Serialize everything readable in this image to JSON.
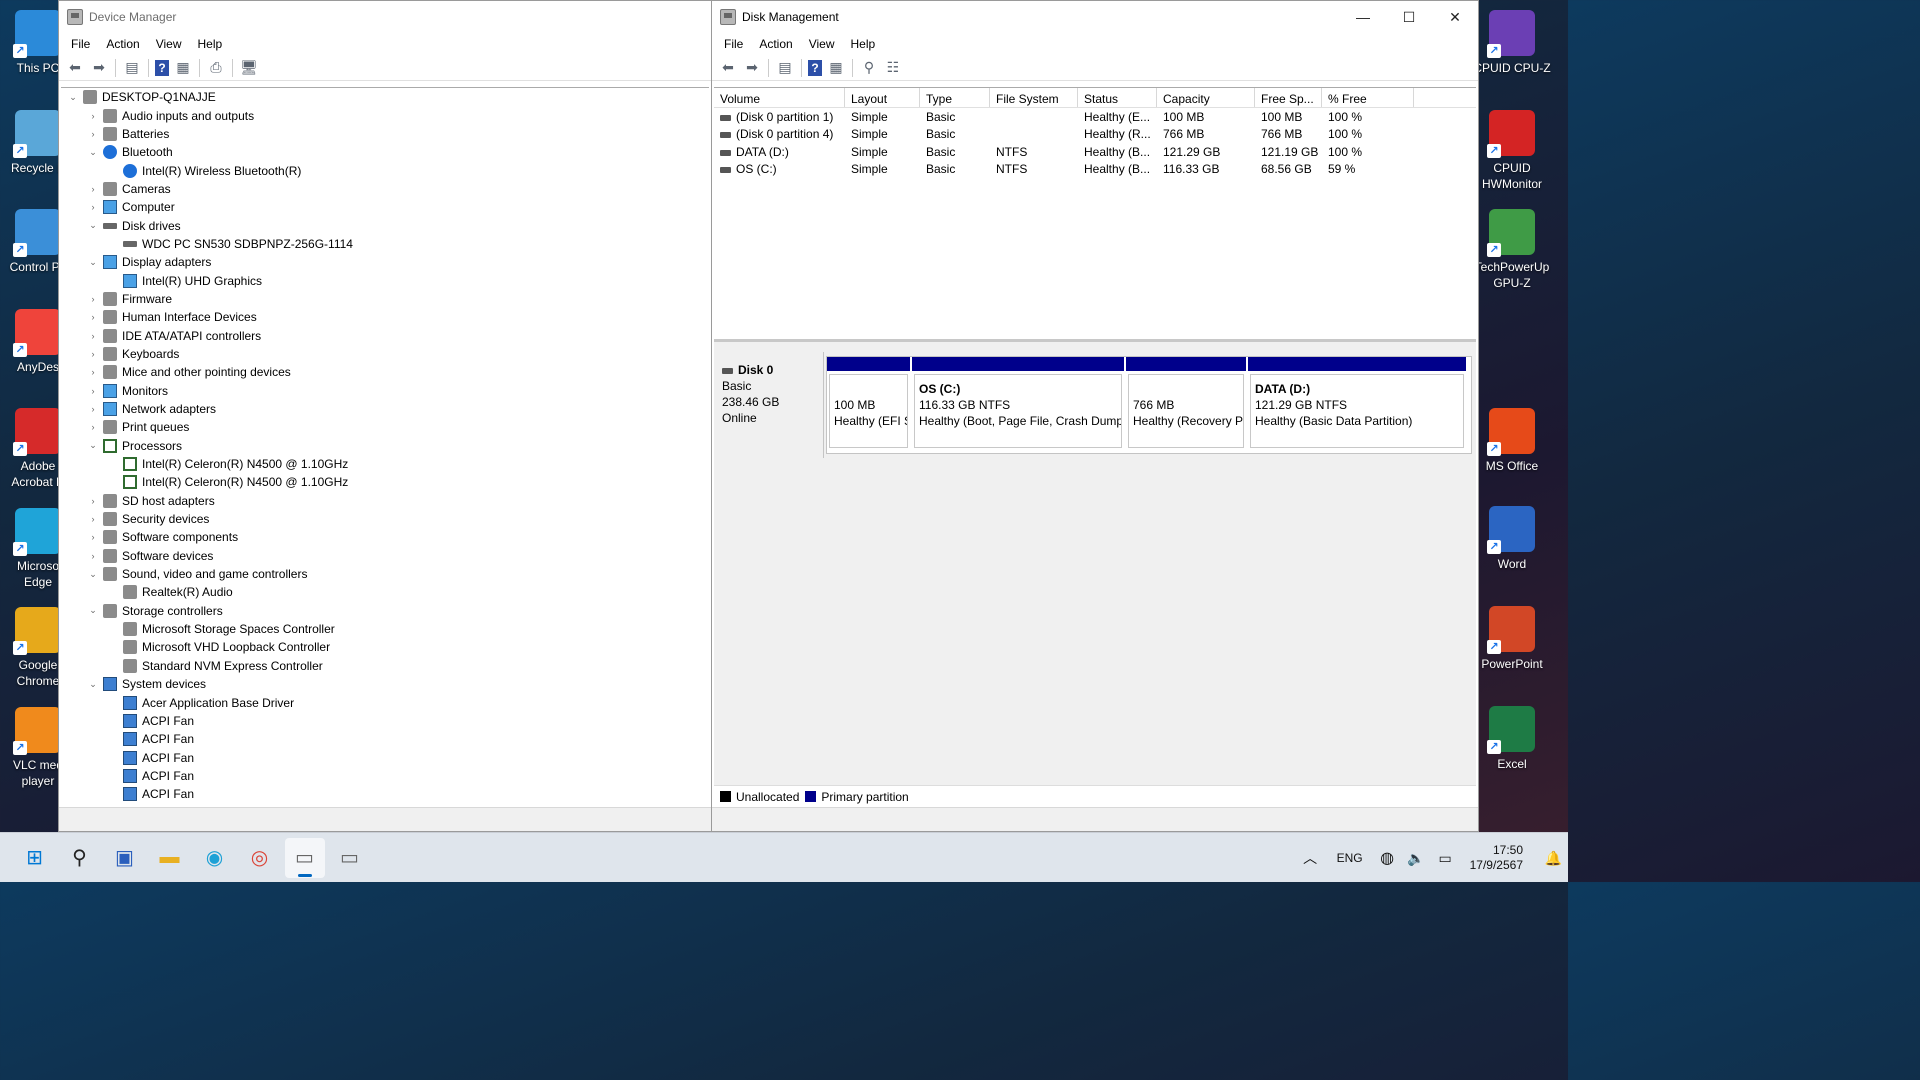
{
  "desktop": {
    "left_icons": [
      {
        "label": "This PC",
        "icon": "this-pc-icon",
        "color": "#2b8ad9"
      },
      {
        "label": "Recycle B",
        "icon": "recycle-bin-icon",
        "color": "#5aa7d8"
      },
      {
        "label": "Control Pa",
        "icon": "control-panel-icon",
        "color": "#3b8fd8"
      },
      {
        "label": "AnyDes",
        "icon": "anydesk-icon",
        "color": "#ef443b"
      },
      {
        "label": "Adobe\nAcrobat D",
        "icon": "acrobat-icon",
        "color": "#d62a2a"
      },
      {
        "label": "Microso\nEdge",
        "icon": "edge-icon",
        "color": "#1fa4d8"
      },
      {
        "label": "Google\nChrome",
        "icon": "chrome-icon",
        "color": "#e6a91b"
      },
      {
        "label": "VLC med\nplayer",
        "icon": "vlc-icon",
        "color": "#f08a1c"
      }
    ],
    "right_icons": [
      {
        "label": "CPUID CPU-Z",
        "icon": "cpuz-icon",
        "color": "#6b3fb4"
      },
      {
        "label": "CPUID\nHWMonitor",
        "icon": "hwmonitor-icon",
        "color": "#d42424"
      },
      {
        "label": "TechPowerUp\nGPU-Z",
        "icon": "gpuz-icon",
        "color": "#3f9b46"
      },
      {
        "label": "MS Office",
        "icon": "ms-office-icon",
        "color": "#e64a19"
      },
      {
        "label": "Word",
        "icon": "word-icon",
        "color": "#2b65c2"
      },
      {
        "label": "PowerPoint",
        "icon": "powerpoint-icon",
        "color": "#d24726"
      },
      {
        "label": "Excel",
        "icon": "excel-icon",
        "color": "#1e7b45"
      }
    ]
  },
  "device_manager": {
    "title": "Device Manager",
    "menu": [
      "File",
      "Action",
      "View",
      "Help"
    ],
    "tree": [
      {
        "level": 0,
        "chev": "⌄",
        "label": "DESKTOP-Q1NAJJE",
        "icon": "computer-icon",
        "cls": "ico-gray"
      },
      {
        "level": 1,
        "chev": "›",
        "label": "Audio inputs and outputs",
        "icon": "speaker-icon",
        "cls": "ico-gray"
      },
      {
        "level": 1,
        "chev": "›",
        "label": "Batteries",
        "icon": "battery-icon",
        "cls": "ico-gray"
      },
      {
        "level": 1,
        "chev": "⌄",
        "label": "Bluetooth",
        "icon": "bluetooth-icon",
        "cls": "ico-bt"
      },
      {
        "level": 2,
        "chev": "",
        "label": "Intel(R) Wireless Bluetooth(R)",
        "icon": "bluetooth-icon",
        "cls": "ico-bt"
      },
      {
        "level": 1,
        "chev": "›",
        "label": "Cameras",
        "icon": "camera-icon",
        "cls": "ico-gray"
      },
      {
        "level": 1,
        "chev": "›",
        "label": "Computer",
        "icon": "monitor-icon",
        "cls": "ico-monitor"
      },
      {
        "level": 1,
        "chev": "⌄",
        "label": "Disk drives",
        "icon": "disk-drive-icon",
        "cls": "ico-disk"
      },
      {
        "level": 2,
        "chev": "",
        "label": "WDC PC SN530 SDBPNPZ-256G-1114",
        "icon": "disk-drive-icon",
        "cls": "ico-disk"
      },
      {
        "level": 1,
        "chev": "⌄",
        "label": "Display adapters",
        "icon": "display-adapter-icon",
        "cls": "ico-monitor"
      },
      {
        "level": 2,
        "chev": "",
        "label": "Intel(R) UHD Graphics",
        "icon": "display-adapter-icon",
        "cls": "ico-monitor"
      },
      {
        "level": 1,
        "chev": "›",
        "label": "Firmware",
        "icon": "firmware-icon",
        "cls": "ico-gray"
      },
      {
        "level": 1,
        "chev": "›",
        "label": "Human Interface Devices",
        "icon": "hid-icon",
        "cls": "ico-gray"
      },
      {
        "level": 1,
        "chev": "›",
        "label": "IDE ATA/ATAPI controllers",
        "icon": "ide-controller-icon",
        "cls": "ico-gray"
      },
      {
        "level": 1,
        "chev": "›",
        "label": "Keyboards",
        "icon": "keyboard-icon",
        "cls": "ico-gray"
      },
      {
        "level": 1,
        "chev": "›",
        "label": "Mice and other pointing devices",
        "icon": "mouse-icon",
        "cls": "ico-gray"
      },
      {
        "level": 1,
        "chev": "›",
        "label": "Monitors",
        "icon": "monitor-icon",
        "cls": "ico-monitor"
      },
      {
        "level": 1,
        "chev": "›",
        "label": "Network adapters",
        "icon": "network-adapter-icon",
        "cls": "ico-monitor"
      },
      {
        "level": 1,
        "chev": "›",
        "label": "Print queues",
        "icon": "printer-icon",
        "cls": "ico-gray"
      },
      {
        "level": 1,
        "chev": "⌄",
        "label": "Processors",
        "icon": "processor-icon",
        "cls": "ico-cpu"
      },
      {
        "level": 2,
        "chev": "",
        "label": "Intel(R) Celeron(R) N4500 @ 1.10GHz",
        "icon": "processor-icon",
        "cls": "ico-cpu"
      },
      {
        "level": 2,
        "chev": "",
        "label": "Intel(R) Celeron(R) N4500 @ 1.10GHz",
        "icon": "processor-icon",
        "cls": "ico-cpu"
      },
      {
        "level": 1,
        "chev": "›",
        "label": "SD host adapters",
        "icon": "sd-adapter-icon",
        "cls": "ico-gray"
      },
      {
        "level": 1,
        "chev": "›",
        "label": "Security devices",
        "icon": "security-device-icon",
        "cls": "ico-gray"
      },
      {
        "level": 1,
        "chev": "›",
        "label": "Software components",
        "icon": "software-component-icon",
        "cls": "ico-gray"
      },
      {
        "level": 1,
        "chev": "›",
        "label": "Software devices",
        "icon": "software-device-icon",
        "cls": "ico-gray"
      },
      {
        "level": 1,
        "chev": "⌄",
        "label": "Sound, video and game controllers",
        "icon": "speaker-icon",
        "cls": "ico-gray"
      },
      {
        "level": 2,
        "chev": "",
        "label": "Realtek(R) Audio",
        "icon": "speaker-icon",
        "cls": "ico-gray"
      },
      {
        "level": 1,
        "chev": "⌄",
        "label": "Storage controllers",
        "icon": "storage-controller-icon",
        "cls": "ico-gray"
      },
      {
        "level": 2,
        "chev": "",
        "label": "Microsoft Storage Spaces Controller",
        "icon": "storage-controller-icon",
        "cls": "ico-gray"
      },
      {
        "level": 2,
        "chev": "",
        "label": "Microsoft VHD Loopback Controller",
        "icon": "storage-controller-icon",
        "cls": "ico-gray"
      },
      {
        "level": 2,
        "chev": "",
        "label": "Standard NVM Express Controller",
        "icon": "storage-controller-icon",
        "cls": "ico-gray"
      },
      {
        "level": 1,
        "chev": "⌄",
        "label": "System devices",
        "icon": "system-device-icon",
        "cls": "ico-sys"
      },
      {
        "level": 2,
        "chev": "",
        "label": "Acer Application Base Driver",
        "icon": "system-device-icon",
        "cls": "ico-sys"
      },
      {
        "level": 2,
        "chev": "",
        "label": "ACPI Fan",
        "icon": "system-device-icon",
        "cls": "ico-sys"
      },
      {
        "level": 2,
        "chev": "",
        "label": "ACPI Fan",
        "icon": "system-device-icon",
        "cls": "ico-sys"
      },
      {
        "level": 2,
        "chev": "",
        "label": "ACPI Fan",
        "icon": "system-device-icon",
        "cls": "ico-sys"
      },
      {
        "level": 2,
        "chev": "",
        "label": "ACPI Fan",
        "icon": "system-device-icon",
        "cls": "ico-sys"
      },
      {
        "level": 2,
        "chev": "",
        "label": "ACPI Fan",
        "icon": "system-device-icon",
        "cls": "ico-sys"
      }
    ]
  },
  "disk_management": {
    "title": "Disk Management",
    "menu": [
      "File",
      "Action",
      "View",
      "Help"
    ],
    "columns": [
      "Volume",
      "Layout",
      "Type",
      "File System",
      "Status",
      "Capacity",
      "Free Sp...",
      "% Free"
    ],
    "volumes": [
      [
        "(Disk 0 partition 1)",
        "Simple",
        "Basic",
        "",
        "Healthy (E...",
        "100 MB",
        "100 MB",
        "100 %"
      ],
      [
        "(Disk 0 partition 4)",
        "Simple",
        "Basic",
        "",
        "Healthy (R...",
        "766 MB",
        "766 MB",
        "100 %"
      ],
      [
        "DATA (D:)",
        "Simple",
        "Basic",
        "NTFS",
        "Healthy (B...",
        "121.29 GB",
        "121.19 GB",
        "100 %"
      ],
      [
        "OS (C:)",
        "Simple",
        "Basic",
        "NTFS",
        "Healthy (B...",
        "116.33 GB",
        "68.56 GB",
        "59 %"
      ]
    ],
    "disk": {
      "name": "Disk 0",
      "type": "Basic",
      "size": "238.46 GB",
      "state": "Online"
    },
    "partitions": [
      {
        "name": "",
        "size": "100 MB",
        "status": "Healthy (EFI S"
      },
      {
        "name": "OS  (C:)",
        "size": "116.33 GB NTFS",
        "status": "Healthy (Boot, Page File, Crash Dump"
      },
      {
        "name": "",
        "size": "766 MB",
        "status": "Healthy (Recovery P"
      },
      {
        "name": "DATA  (D:)",
        "size": "121.29 GB NTFS",
        "status": "Healthy (Basic Data Partition)"
      }
    ],
    "legend": [
      {
        "label": "Unallocated",
        "color": "#000000"
      },
      {
        "label": "Primary partition",
        "color": "#00008b"
      }
    ]
  },
  "taskbar": {
    "apps": [
      "start-icon",
      "search-icon",
      "store-icon",
      "file-explorer-icon",
      "edge-icon",
      "chrome-icon",
      "device-manager-icon",
      "disk-management-icon"
    ],
    "language": "ENG",
    "time": "17:50",
    "date": "17/9/2567"
  }
}
